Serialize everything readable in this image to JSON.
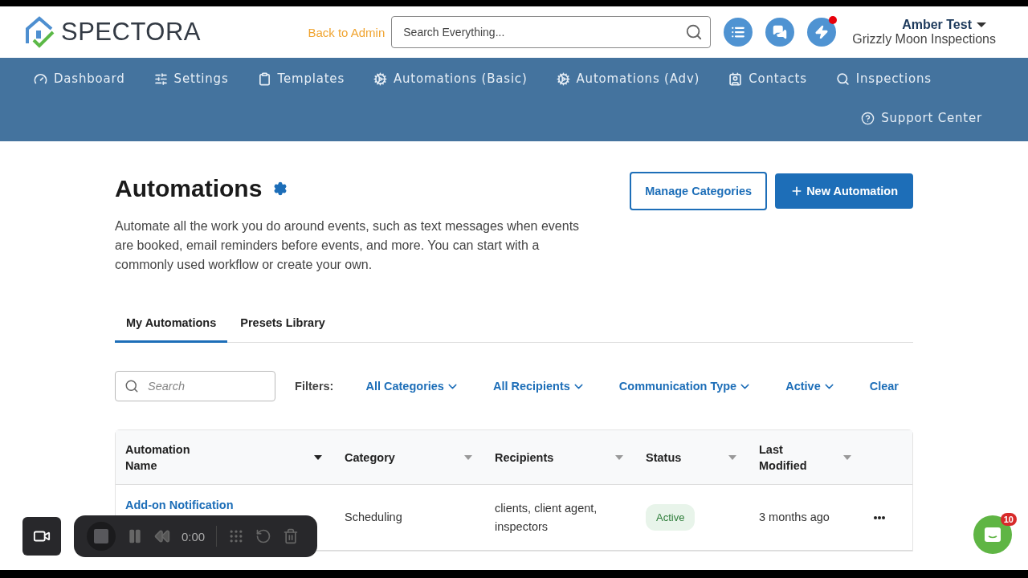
{
  "header": {
    "logo_text": "SPECTORA",
    "back_link": "Back to Admin",
    "search": {
      "placeholder": "Search Everything..."
    },
    "actions": [
      {
        "kind": "list",
        "has_notification": false
      },
      {
        "kind": "chat",
        "has_notification": false
      },
      {
        "kind": "bolt",
        "has_notification": true
      }
    ],
    "user": {
      "name": "Amber Test",
      "company": "Grizzly Moon Inspections"
    }
  },
  "nav": {
    "items": [
      {
        "kind": "dashboard",
        "label": "Dashboard"
      },
      {
        "kind": "settings",
        "label": "Settings"
      },
      {
        "kind": "templates",
        "label": "Templates"
      },
      {
        "kind": "cogs",
        "label": "Automations (Basic)"
      },
      {
        "kind": "cogs",
        "label": "Automations (Adv)"
      },
      {
        "kind": "contacts",
        "label": "Contacts"
      },
      {
        "kind": "search",
        "label": "Inspections"
      }
    ],
    "support": "Support Center"
  },
  "page": {
    "title": "Automations",
    "description": "Automate all the work you do around events, such as text messages when events are booked, email reminders before events, and more. You can start with a commonly used workflow or create your own.",
    "buttons": [
      {
        "kind": "outline",
        "label": "Manage Categories"
      },
      {
        "kind": "primary",
        "label": "New Automation"
      }
    ]
  },
  "tabs": [
    {
      "label": "My Automations",
      "selected": true
    },
    {
      "label": "Presets Library",
      "selected": false
    }
  ],
  "filters": {
    "search_placeholder": "Search",
    "label": "Filters:",
    "items": [
      "All Categories",
      "All Recipients",
      "Communication Type",
      "Active"
    ],
    "clear": "Clear"
  },
  "table": {
    "columns": [
      {
        "label": "Automation Name",
        "sorted": true
      },
      {
        "label": "Category",
        "sorted": false
      },
      {
        "label": "Recipients",
        "sorted": false
      },
      {
        "label": "Status",
        "sorted": false
      },
      {
        "label": "Last Modified",
        "sorted": false
      }
    ],
    "rows": [
      {
        "name": "Add-on Notification",
        "category": "Scheduling",
        "recipients": "clients, client agent, inspectors",
        "status": "Active",
        "modified": "3 months ago"
      }
    ]
  },
  "recorder": {
    "time": "0:00"
  },
  "chat": {
    "badge": "10"
  }
}
